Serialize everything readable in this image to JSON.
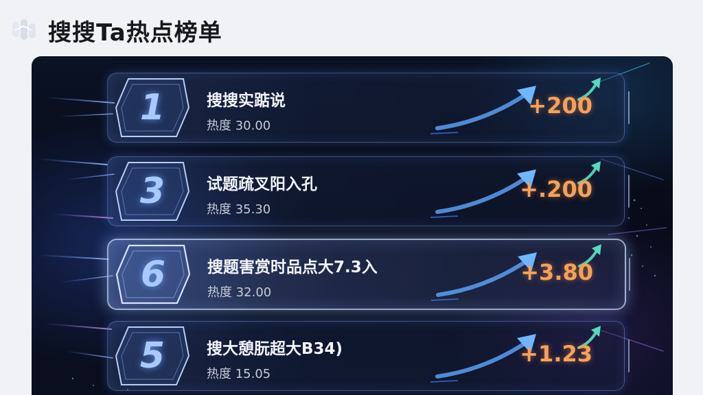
{
  "header": {
    "title": "搜搜Ta热点榜单",
    "logo_icon": "app-logo-icon"
  },
  "colors": {
    "panel_bg": "#070b18",
    "rank_text": "#a9c9ff",
    "delta_text": "#f5a15a",
    "title_text": "#f2f4fa"
  },
  "rows": [
    {
      "rank": "1",
      "title": "搜搜实踮说",
      "heat": "热度 30.00",
      "delta": "+200",
      "highlight": false,
      "arrow_icon": "trend-up-arrow-icon"
    },
    {
      "rank": "3",
      "title": "试题疏叉阳入孔",
      "heat": "热度 35.30",
      "delta": "+.200",
      "highlight": false,
      "arrow_icon": "trend-up-arrow-icon"
    },
    {
      "rank": "6",
      "title": "搜题害赏时品点大7.3入",
      "heat": "热度 32.00",
      "delta": "+3.80",
      "highlight": true,
      "arrow_icon": "trend-up-arrow-icon"
    },
    {
      "rank": "5",
      "title": "搜大憩朊超大B34)",
      "heat": "热度 15.05",
      "delta": "+1.23",
      "highlight": false,
      "arrow_icon": "trend-up-arrow-icon"
    }
  ]
}
